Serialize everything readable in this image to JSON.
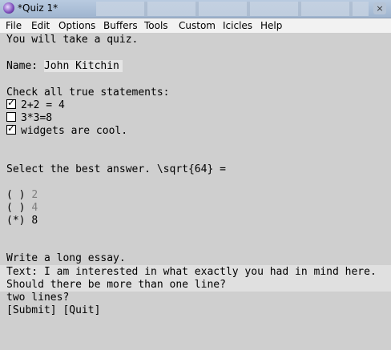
{
  "window": {
    "title": "*Quiz 1*",
    "close_glyph": "×"
  },
  "menu": [
    "File",
    "Edit",
    "Options",
    "Buffers",
    "Tools",
    "Custom",
    "Icicles",
    "Help"
  ],
  "quiz": {
    "intro": "You will take a quiz.",
    "name_label": "Name: ",
    "name_value": "John Kitchin",
    "check_prompt": "Check all true statements:",
    "checkboxes": [
      {
        "label": "2+2 = 4",
        "checked": true
      },
      {
        "label": "3*3=8",
        "checked": false
      },
      {
        "label": "widgets are cool.",
        "checked": true
      }
    ],
    "radio_prompt": "Select the best answer. \\sqrt{64} =",
    "radios": [
      {
        "marker": "( )",
        "label": "2",
        "selected": false
      },
      {
        "marker": "( )",
        "label": "4",
        "selected": false
      },
      {
        "marker": "(*)",
        "label": "8",
        "selected": true
      }
    ],
    "essay_prompt": "Write a long essay.",
    "essay_label": "Text: ",
    "essay_lines": [
      "I am interested in what exactly you had in mind here.",
      "Should there be more than one line?",
      "two lines?"
    ],
    "submit": "[Submit]",
    "quit": "[Quit]"
  }
}
